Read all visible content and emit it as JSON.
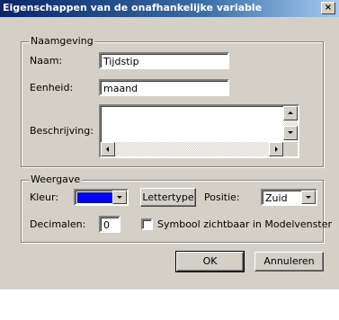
{
  "window": {
    "title": "Eigenschappen van de onafhankelijke variable",
    "close_glyph": "×"
  },
  "naamgeving": {
    "legend": "Naamgeving",
    "naam_label": "Naam:",
    "naam_value": "Tijdstip",
    "eenheid_label": "Eenheid:",
    "eenheid_value": "maand",
    "beschrijving_label": "Beschrijving:",
    "beschrijving_value": ""
  },
  "weergave": {
    "legend": "Weergave",
    "kleur_label": "Kleur:",
    "kleur_color": "#0000ff",
    "lettertype_button": "Lettertype",
    "positie_label": "Positie:",
    "positie_value": "Zuid",
    "decimalen_label": "Decimalen:",
    "decimalen_value": "0",
    "symbool_label": "Symbool zichtbaar in Modelvenster",
    "symbool_checked": false
  },
  "buttons": {
    "ok": "OK",
    "cancel": "Annuleren"
  }
}
